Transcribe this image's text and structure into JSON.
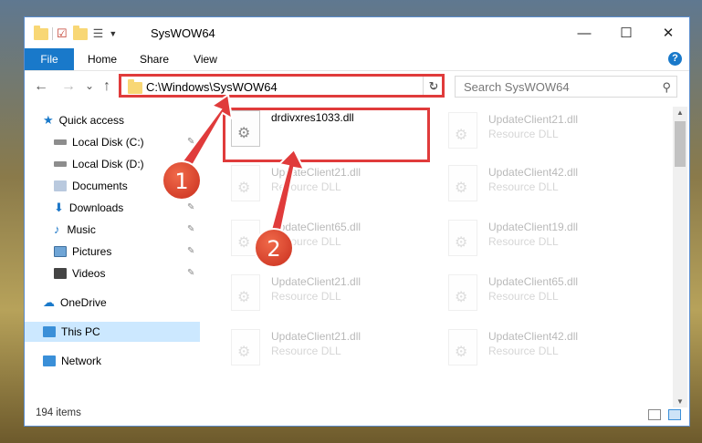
{
  "window": {
    "title": "SysWOW64"
  },
  "ribbon": {
    "tabs": [
      "File",
      "Home",
      "Share",
      "View"
    ],
    "help": "?"
  },
  "controls": {
    "minimize": "—",
    "maximize": "☐",
    "close": "✕"
  },
  "nav": {
    "back": "←",
    "forward": "→",
    "recent": "⌄",
    "up": "↑",
    "refresh": "↻",
    "address_dropdown": "⌄"
  },
  "address": {
    "path": "C:\\Windows\\SysWOW64"
  },
  "search": {
    "placeholder": "Search SysWOW64",
    "icon": "search-icon"
  },
  "sidebar": {
    "items": [
      {
        "label": "Quick access",
        "icon": "star-icon",
        "color": "#1979ca"
      },
      {
        "label": "Local Disk (C:)",
        "icon": "drive-icon",
        "color": "#777777",
        "pinned": true
      },
      {
        "label": "Local Disk (D:)",
        "icon": "drive-icon",
        "color": "#777777",
        "pinned": true
      },
      {
        "label": "Documents",
        "icon": "documents-icon",
        "color": "#6b8fbf",
        "pinned": true
      },
      {
        "label": "Downloads",
        "icon": "downloads-icon",
        "color": "#1e78c8",
        "pinned": true
      },
      {
        "label": "Music",
        "icon": "music-icon",
        "color": "#1e78c8",
        "pinned": true
      },
      {
        "label": "Pictures",
        "icon": "pictures-icon",
        "color": "#4a90c8",
        "pinned": true
      },
      {
        "label": "Videos",
        "icon": "videos-icon",
        "color": "#555555",
        "pinned": true
      },
      {
        "label": "OneDrive",
        "icon": "cloud-icon",
        "color": "#1979ca"
      },
      {
        "label": "This PC",
        "icon": "computer-icon",
        "color": "#3a8fd8",
        "selected": true
      },
      {
        "label": "Network",
        "icon": "network-icon",
        "color": "#3a8fd8"
      }
    ]
  },
  "files": [
    {
      "name": "drdivxres1033.dll",
      "type": "",
      "highlighted": true
    },
    {
      "name": "UpdateClient21.dll",
      "type": "Resource DLL"
    },
    {
      "name": "UpdateClient21.dll",
      "type": "Resource DLL"
    },
    {
      "name": "UpdateClient42.dll",
      "type": "Resource DLL"
    },
    {
      "name": "UpdateClient65.dll",
      "type": "Resource DLL"
    },
    {
      "name": "UpdateClient19.dll",
      "type": "Resource DLL"
    },
    {
      "name": "UpdateClient21.dll",
      "type": "Resource DLL"
    },
    {
      "name": "UpdateClient65.dll",
      "type": "Resource DLL"
    },
    {
      "name": "UpdateClient21.dll",
      "type": "Resource DLL"
    },
    {
      "name": "UpdateClient42.dll",
      "type": "Resource DLL"
    }
  ],
  "status": {
    "item_count": "194 items"
  },
  "callouts": {
    "one": "1",
    "two": "2",
    "color": "#e03b3b"
  },
  "colors": {
    "accent": "#1979ca",
    "highlight": "#e03b3b",
    "selected_bg": "#cce8ff"
  }
}
